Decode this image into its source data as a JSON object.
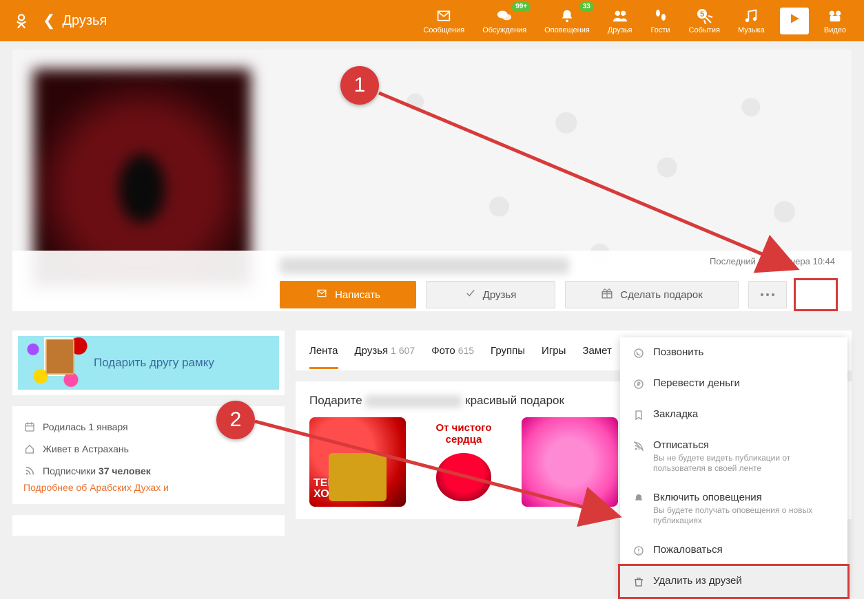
{
  "header": {
    "back_label": "Друзья",
    "nav": [
      {
        "id": "messages",
        "label": "Сообщения"
      },
      {
        "id": "discussions",
        "label": "Обсуждения",
        "badge": "99+"
      },
      {
        "id": "notifications",
        "label": "Оповещения",
        "badge": "33"
      },
      {
        "id": "friends",
        "label": "Друзья"
      },
      {
        "id": "guests",
        "label": "Гости"
      },
      {
        "id": "events",
        "label": "События",
        "badge": "5"
      },
      {
        "id": "music",
        "label": "Музыка"
      },
      {
        "id": "video",
        "label": "Видео"
      }
    ]
  },
  "profile": {
    "last_visit": "Последний визит: вчера 10:44",
    "actions": {
      "write": "Написать",
      "friends": "Друзья",
      "gift": "Сделать подарок"
    }
  },
  "left": {
    "gift_frame_label": "Подарить другу рамку",
    "info": {
      "born": "Родилась 1 января",
      "lives": "Живет в Астрахань",
      "subs_prefix": "Подписчики ",
      "subs_count": "37 человек",
      "more": "Подробнее об Арабских Духах и"
    }
  },
  "tabs": [
    {
      "label": "Лента",
      "count": "",
      "active": true
    },
    {
      "label": "Друзья",
      "count": "1 607"
    },
    {
      "label": "Фото",
      "count": "615"
    },
    {
      "label": "Группы",
      "count": ""
    },
    {
      "label": "Игры",
      "count": ""
    },
    {
      "label": "Замет",
      "count": ""
    }
  ],
  "feed": {
    "title_prefix": "Подарите ",
    "title_suffix": " красивый подарок",
    "gift1": "ТЕБЕ, МОЯ\nХОРОШАЯ!",
    "gift2": "От чистого\nсердца"
  },
  "menu": [
    {
      "id": "call",
      "label": "Позвонить"
    },
    {
      "id": "money",
      "label": "Перевести деньги"
    },
    {
      "id": "bookmark",
      "label": "Закладка"
    },
    {
      "id": "unfollow",
      "label": "Отписаться",
      "sub": "Вы не будете видеть публикации от пользователя в своей ленте"
    },
    {
      "id": "notify",
      "label": "Включить оповещения",
      "sub": "Вы будете получать оповещения о новых публикациях"
    },
    {
      "id": "complain",
      "label": "Пожаловаться"
    },
    {
      "id": "unfriend",
      "label": "Удалить из друзей",
      "highlight": true
    }
  ],
  "anno": {
    "one": "1",
    "two": "2"
  }
}
